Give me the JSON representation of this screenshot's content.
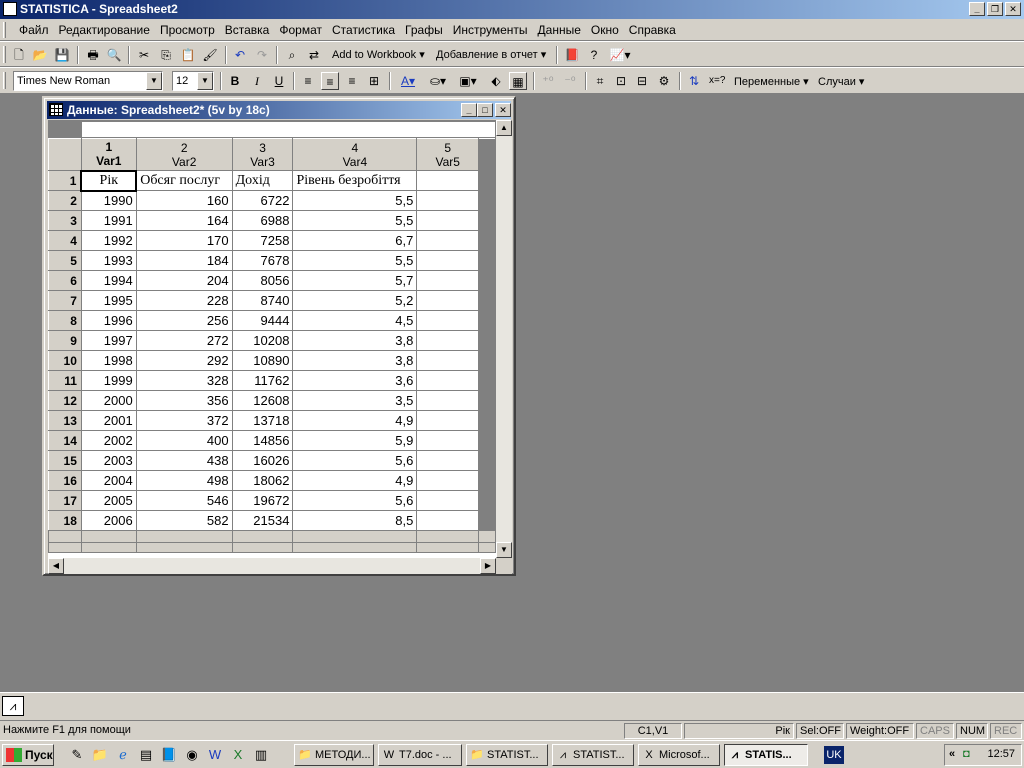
{
  "app": {
    "title": "STATISTICA - Spreadsheet2",
    "window_buttons": [
      "_",
      "❐",
      "✕"
    ]
  },
  "menu": [
    "Файл",
    "Редактирование",
    "Просмотр",
    "Вставка",
    "Формат",
    "Статистика",
    "Графы",
    "Инструменты",
    "Данные",
    "Окно",
    "Справка"
  ],
  "toolbar1": {
    "add_to_workbook": "Add to Workbook ▾",
    "add_to_report": "Добавление в отчет ▾"
  },
  "toolbar2": {
    "font_name": "Times New Roman",
    "font_size": "12",
    "bold": "B",
    "italic": "I",
    "underline": "U",
    "variables": "Переменные ▾",
    "cases": "Случаи ▾",
    "xeq": "x=?"
  },
  "spreadsheet": {
    "title": "Данные: Spreadsheet2* (5v by 18c)",
    "columns": [
      {
        "num": "1",
        "name": "Var1"
      },
      {
        "num": "2",
        "name": "Var2"
      },
      {
        "num": "3",
        "name": "Var3"
      },
      {
        "num": "4",
        "name": "Var4"
      },
      {
        "num": "5",
        "name": "Var5"
      }
    ],
    "rows": [
      {
        "n": "1",
        "cells": [
          "Рік",
          "Обсяг послуг",
          "Дохід",
          "Рівень безробіття",
          ""
        ]
      },
      {
        "n": "2",
        "cells": [
          "1990",
          "160",
          "6722",
          "5,5",
          ""
        ]
      },
      {
        "n": "3",
        "cells": [
          "1991",
          "164",
          "6988",
          "5,5",
          ""
        ]
      },
      {
        "n": "4",
        "cells": [
          "1992",
          "170",
          "7258",
          "6,7",
          ""
        ]
      },
      {
        "n": "5",
        "cells": [
          "1993",
          "184",
          "7678",
          "5,5",
          ""
        ]
      },
      {
        "n": "6",
        "cells": [
          "1994",
          "204",
          "8056",
          "5,7",
          ""
        ]
      },
      {
        "n": "7",
        "cells": [
          "1995",
          "228",
          "8740",
          "5,2",
          ""
        ]
      },
      {
        "n": "8",
        "cells": [
          "1996",
          "256",
          "9444",
          "4,5",
          ""
        ]
      },
      {
        "n": "9",
        "cells": [
          "1997",
          "272",
          "10208",
          "3,8",
          ""
        ]
      },
      {
        "n": "10",
        "cells": [
          "1998",
          "292",
          "10890",
          "3,8",
          ""
        ]
      },
      {
        "n": "11",
        "cells": [
          "1999",
          "328",
          "11762",
          "3,6",
          ""
        ]
      },
      {
        "n": "12",
        "cells": [
          "2000",
          "356",
          "12608",
          "3,5",
          ""
        ]
      },
      {
        "n": "13",
        "cells": [
          "2001",
          "372",
          "13718",
          "4,9",
          ""
        ]
      },
      {
        "n": "14",
        "cells": [
          "2002",
          "400",
          "14856",
          "5,9",
          ""
        ]
      },
      {
        "n": "15",
        "cells": [
          "2003",
          "438",
          "16026",
          "5,6",
          ""
        ]
      },
      {
        "n": "16",
        "cells": [
          "2004",
          "498",
          "18062",
          "4,9",
          ""
        ]
      },
      {
        "n": "17",
        "cells": [
          "2005",
          "546",
          "19672",
          "5,6",
          ""
        ]
      },
      {
        "n": "18",
        "cells": [
          "2006",
          "582",
          "21534",
          "8,5",
          ""
        ]
      }
    ]
  },
  "status": {
    "help": "Нажмите F1 для помощи",
    "cell": "C1,V1",
    "value": "Рік",
    "sel": "Sel:OFF",
    "weight": "Weight:OFF",
    "caps": "CAPS",
    "num": "NUM",
    "rec": "REC"
  },
  "taskbar": {
    "start": "Пуск",
    "tasks": [
      "МЕТОДИ...",
      "T7.doc - ...",
      "STATIST...",
      "STATIST...",
      "Microsof...",
      "STATIS..."
    ],
    "lang": "UK",
    "tray_arrows": "«",
    "clock": "12:57"
  }
}
